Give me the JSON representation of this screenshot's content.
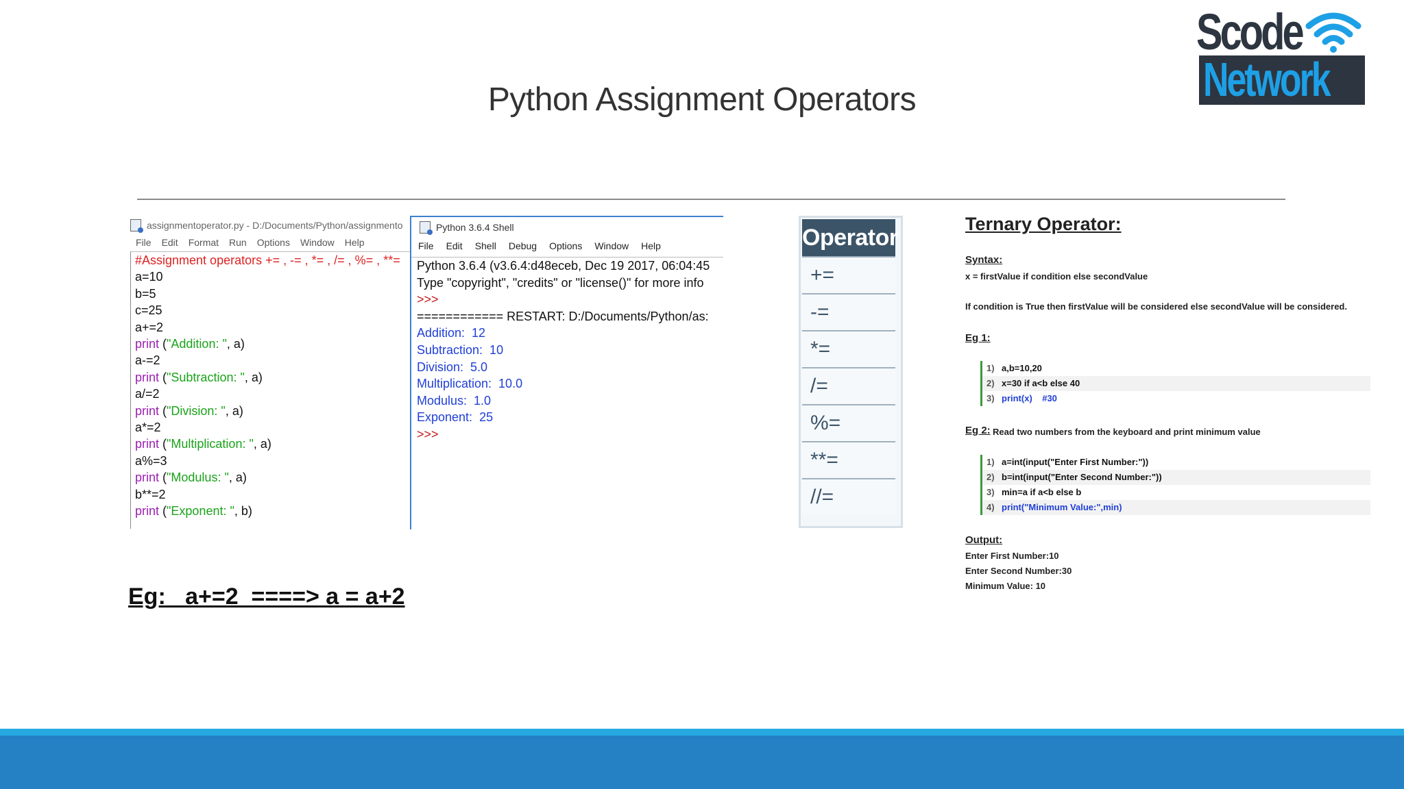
{
  "title": "Python Assignment Operators",
  "logo": {
    "line1": "Scode",
    "line2": "Network"
  },
  "editor": {
    "title": "assignmentoperator.py - D:/Documents/Python/assignmento",
    "menu": [
      "File",
      "Edit",
      "Format",
      "Run",
      "Options",
      "Window",
      "Help"
    ],
    "comment": "#Assignment operators += , -= , *= , /= , %= , **=",
    "lines": {
      "l1": "a=10",
      "l2": "b=5",
      "l3": "c=25",
      "l4": "a+=2",
      "l5_kw": "print",
      "l5_rest": " (",
      "l5_str": "\"Addition: \"",
      "l5_end": ", a)",
      "l6": "a-=2",
      "l7_kw": "print",
      "l7_rest": " (",
      "l7_str": "\"Subtraction: \"",
      "l7_end": ", a)",
      "l8": "a/=2",
      "l9_kw": "print",
      "l9_rest": " (",
      "l9_str": "\"Division: \"",
      "l9_end": ", a)",
      "l10": "a*=2",
      "l11_kw": "print",
      "l11_rest": " (",
      "l11_str": "\"Multiplication: \"",
      "l11_end": ", a)",
      "l12": "a%=3",
      "l13_kw": "print",
      "l13_rest": " (",
      "l13_str": "\"Modulus: \"",
      "l13_end": ", a)",
      "l14": "b**=2",
      "l15_kw": "print",
      "l15_rest": " (",
      "l15_str": "\"Exponent: \"",
      "l15_end": ", b)"
    }
  },
  "shell": {
    "title": "Python 3.6.4 Shell",
    "menu": [
      "File",
      "Edit",
      "Shell",
      "Debug",
      "Options",
      "Window",
      "Help"
    ],
    "header1": "Python 3.6.4 (v3.6.4:d48eceb, Dec 19 2017, 06:04:45",
    "header2": "Type \"copyright\", \"credits\" or \"license()\" for more info",
    "prompt": ">>>",
    "restart": "============ RESTART: D:/Documents/Python/as:",
    "results": [
      "Addition:  12",
      "Subtraction:  10",
      "Division:  5.0",
      "Multiplication:  10.0",
      "Modulus:  1.0",
      "Exponent:  25"
    ]
  },
  "operators": {
    "header": "Operator",
    "items": [
      "+=",
      "-=",
      "*=",
      "/=",
      "%=",
      "**=",
      "//="
    ]
  },
  "ternary": {
    "title": "Ternary Operator:",
    "syntax_label": "Syntax:",
    "syntax_text": "x =  firstValue if condition else secondValue",
    "explanation": "If condition is True then firstValue will be considered else secondValue will be considered.",
    "eg1_label": "Eg 1:",
    "eg1_code": [
      "a,b=10,20",
      "x=30 if a<b else 40",
      "print(x)    #30"
    ],
    "eg2_label": "Eg 2:",
    "eg2_text": "Read two numbers from the keyboard and print minimum value",
    "eg2_code": [
      "a=int(input(\"Enter First Number:\"))",
      "b=int(input(\"Enter Second Number:\"))",
      "min=a if a<b else b",
      "print(\"Minimum Value:\",min)"
    ],
    "output_label": "Output:",
    "output_lines": [
      "Enter First Number:10",
      "Enter Second Number:30",
      "Minimum Value: 10"
    ]
  },
  "example": "Eg:   a+=2  ====> a = a+2",
  "colors": {
    "footer": "#2580c4",
    "footer_accent": "#26a9e0",
    "operator_header": "#3c5468"
  }
}
